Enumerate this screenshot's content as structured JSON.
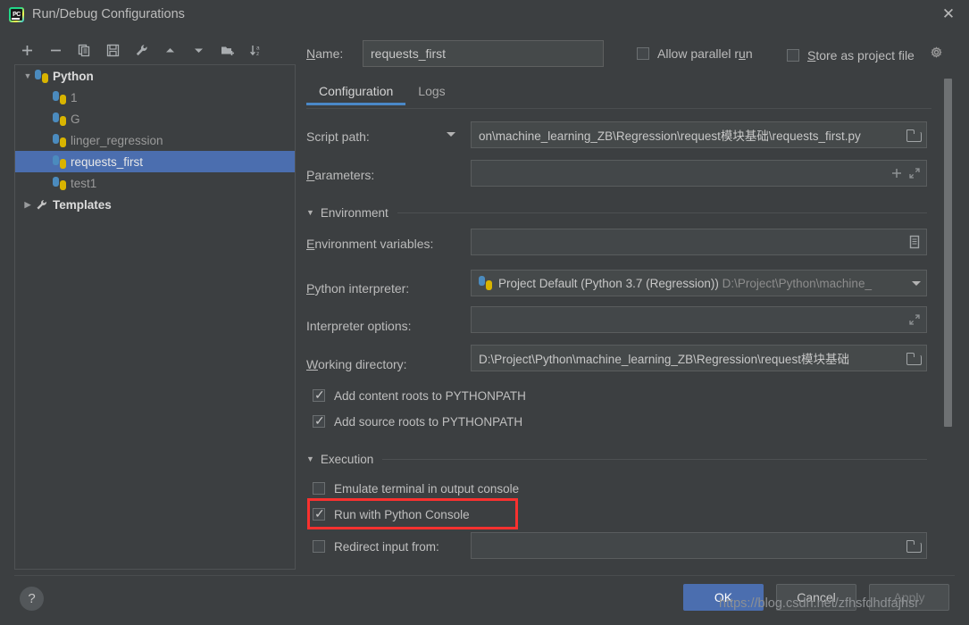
{
  "window": {
    "title": "Run/Debug Configurations",
    "app_icon": "pycharm-logo-icon",
    "close_icon": "✕"
  },
  "toolbar": {
    "buttons": [
      {
        "name": "add-configuration-button",
        "glyph": "+"
      },
      {
        "name": "remove-configuration-button",
        "glyph": "−"
      },
      {
        "name": "copy-configuration-button",
        "glyph": "copy-icon"
      },
      {
        "name": "save-configuration-button",
        "glyph": "save-icon"
      },
      {
        "name": "edit-templates-button",
        "glyph": "wrench-icon"
      },
      {
        "name": "move-up-button",
        "glyph": "▲"
      },
      {
        "name": "move-down-button",
        "glyph": "▼"
      },
      {
        "name": "new-folder-button",
        "glyph": "folder-plus-icon"
      },
      {
        "name": "sort-alphabetically-button",
        "glyph": "sort-az-icon"
      }
    ]
  },
  "tree": {
    "nodes": [
      {
        "label": "Python",
        "type": "root",
        "expanded": true,
        "icon": "python-icon"
      },
      {
        "label": "1",
        "type": "child",
        "icon": "python-icon"
      },
      {
        "label": "G",
        "type": "child",
        "icon": "python-icon"
      },
      {
        "label": "linger_regression",
        "type": "child",
        "icon": "python-icon"
      },
      {
        "label": "requests_first",
        "type": "child",
        "icon": "python-icon",
        "selected": true
      },
      {
        "label": "test1",
        "type": "child",
        "icon": "python-icon"
      },
      {
        "label": "Templates",
        "type": "root",
        "expanded": false,
        "icon": "wrench-icon"
      }
    ]
  },
  "header": {
    "name_label": "Name:",
    "name_value": "requests_first",
    "allow_parallel_run": {
      "label": "Allow parallel run",
      "checked": false
    },
    "store_as_project_file": {
      "label": "Store as project file",
      "checked": false
    },
    "gear_icon": "gear-icon"
  },
  "tabs": [
    {
      "label": "Configuration",
      "active": true
    },
    {
      "label": "Logs",
      "active": false
    }
  ],
  "form": {
    "script_path": {
      "label": "Script path:",
      "value": "on\\machine_learning_ZB\\Regression\\request模块基础\\requests_first.py",
      "browse_icon": "folder-icon"
    },
    "parameters": {
      "label": "Parameters:",
      "value": "",
      "add_icon": "plus-icon",
      "expand_icon": "expand-icon"
    },
    "environment_section": {
      "label": "Environment",
      "expanded": true
    },
    "environment_variables": {
      "label": "Environment variables:",
      "value": "",
      "browse_icon": "list-icon"
    },
    "python_interpreter": {
      "label": "Python interpreter:",
      "value": "Project Default (Python 3.7 (Regression))",
      "value_path": "D:\\Project\\Python\\machine_",
      "icon": "python-interpreter-icon",
      "dropdown_icon": "chevron-down-icon"
    },
    "interpreter_options": {
      "label": "Interpreter options:",
      "value": "",
      "expand_icon": "expand-icon"
    },
    "working_directory": {
      "label": "Working directory:",
      "value": "D:\\Project\\Python\\machine_learning_ZB\\Regression\\request模块基础",
      "browse_icon": "folder-icon"
    },
    "add_content_roots": {
      "label": "Add content roots to PYTHONPATH",
      "checked": true
    },
    "add_source_roots": {
      "label": "Add source roots to PYTHONPATH",
      "checked": true
    },
    "execution_section": {
      "label": "Execution",
      "expanded": true
    },
    "emulate_terminal": {
      "label": "Emulate terminal in output console",
      "checked": false
    },
    "run_with_python_console": {
      "label": "Run with Python Console",
      "checked": true,
      "highlighted": true
    },
    "redirect_input": {
      "label": "Redirect input from:",
      "checked": false,
      "value": "",
      "browse_icon": "folder-icon"
    }
  },
  "footer": {
    "help_label": "?",
    "ok_label": "OK",
    "cancel_label": "Cancel",
    "apply_label": "Apply"
  },
  "watermark": "https://blog.csdn.net/zfhsfdhdfajhsr",
  "colors": {
    "accent_blue": "#4b6eaf",
    "tab_underline": "#4a88c7",
    "annotation_red": "#f8312f",
    "background": "#3c3f41",
    "field_background": "#45494a"
  }
}
